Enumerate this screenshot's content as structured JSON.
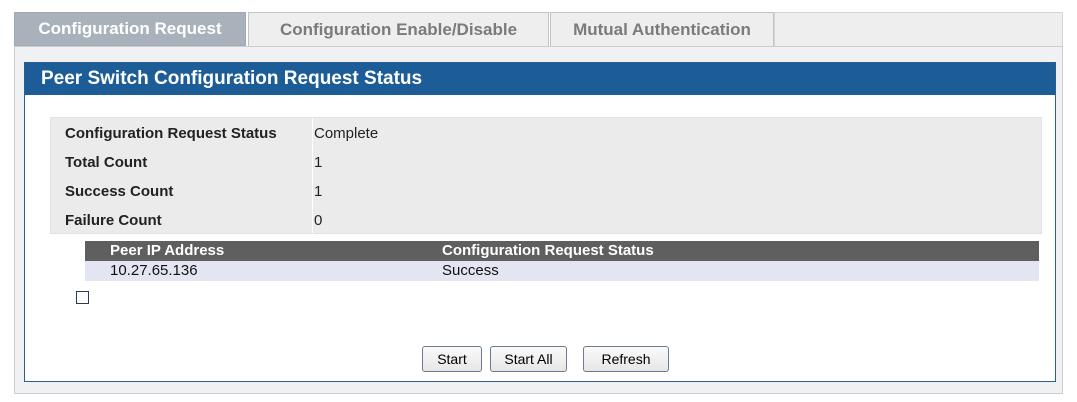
{
  "tabs": [
    {
      "label": "Configuration Request",
      "active": true
    },
    {
      "label": "Configuration Enable/Disable",
      "active": false
    },
    {
      "label": "Mutual Authentication",
      "active": false
    }
  ],
  "panel": {
    "title": "Peer Switch Configuration Request Status"
  },
  "status": [
    {
      "label": "Configuration Request Status",
      "value": "Complete"
    },
    {
      "label": "Total Count",
      "value": "1"
    },
    {
      "label": "Success Count",
      "value": "1"
    },
    {
      "label": "Failure Count",
      "value": "0"
    }
  ],
  "peer_table": {
    "headers": [
      "Peer IP Address",
      "Configuration Request Status"
    ],
    "rows": [
      {
        "ip": "10.27.65.136",
        "status": "Success",
        "checked": false
      }
    ]
  },
  "buttons": {
    "start": "Start",
    "start_all": "Start All",
    "refresh": "Refresh"
  },
  "colors": {
    "header_bg": "#1c5d97",
    "tab_active_bg": "#a9b2bb",
    "table_header_bg": "#5f5f5f",
    "row_bg": "#e4e5f3"
  }
}
